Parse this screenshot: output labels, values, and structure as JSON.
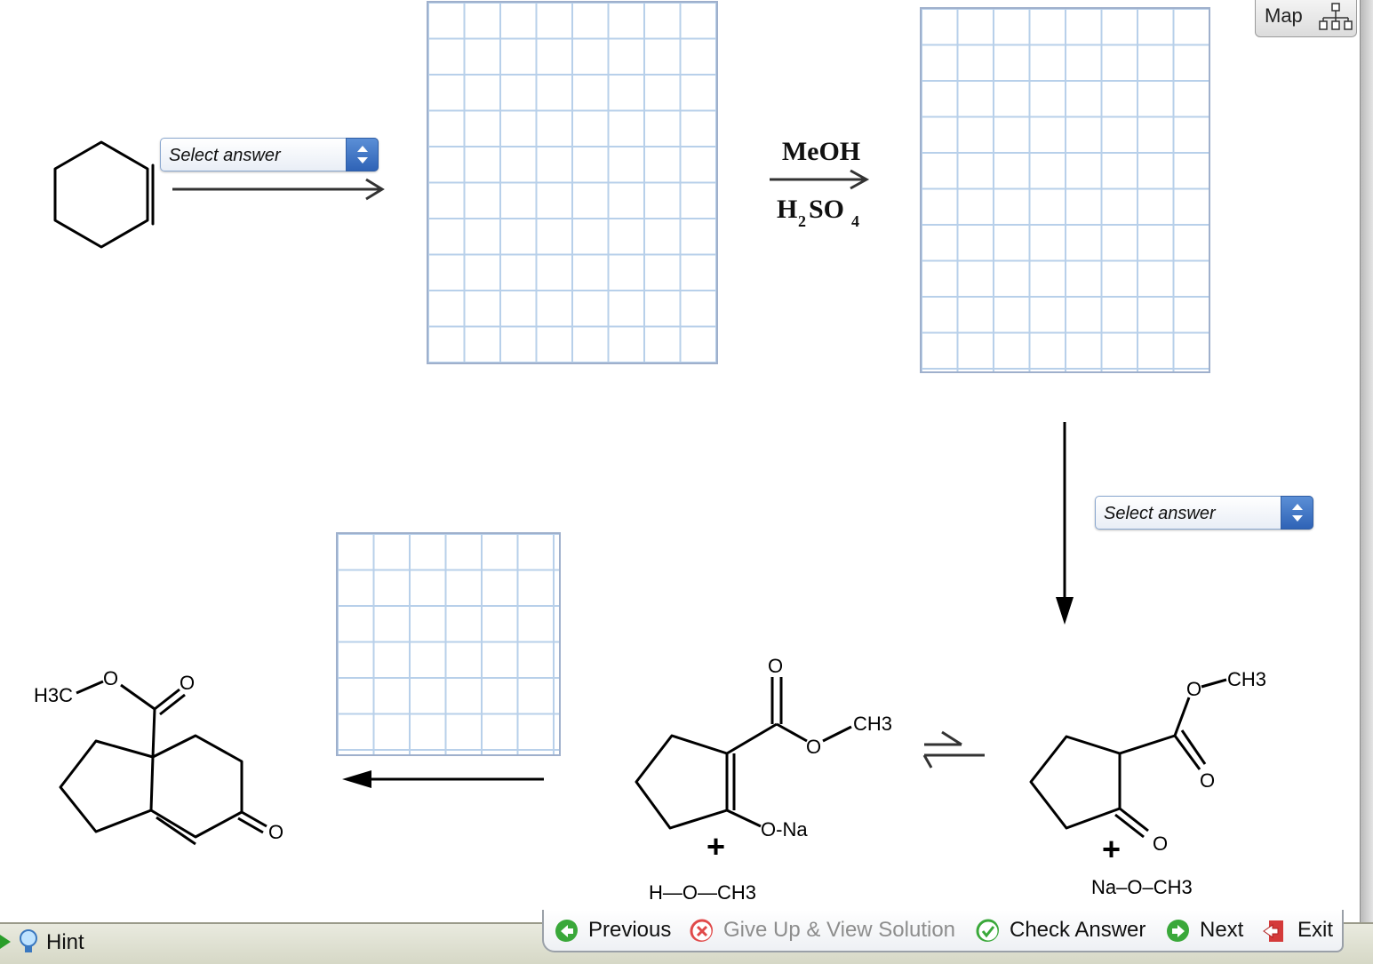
{
  "reaction": {
    "step1_select": "Select answer",
    "step2_reagent_top": "MeOH",
    "step2_reagent_bottom": "H2SO4",
    "step3_select": "Select answer"
  },
  "structures": {
    "enolate_labels": {
      "carbonyl_O": "O",
      "ester_O": "O",
      "methyl": "CH3",
      "ONa": "O-Na",
      "plus": "+",
      "methanol": "H—O—CH3"
    },
    "ketoester_labels": {
      "ester_O": "O",
      "methyl": "CH3",
      "carbonyl_O": "O",
      "ketone_O": "O",
      "plus": "+",
      "methoxide": "Na–O–CH3"
    },
    "product_labels": {
      "methyl": "H3C",
      "ester_O": "O",
      "carbonyl_O": "O",
      "ketone_O": "O"
    }
  },
  "top_right": {
    "map_label": "Map",
    "map_icon": "tree-map-icon"
  },
  "bottom": {
    "hint_label": "Hint",
    "nav": {
      "previous": "Previous",
      "give_up": "Give Up & View Solution",
      "check": "Check Answer",
      "next": "Next",
      "exit": "Exit"
    }
  }
}
